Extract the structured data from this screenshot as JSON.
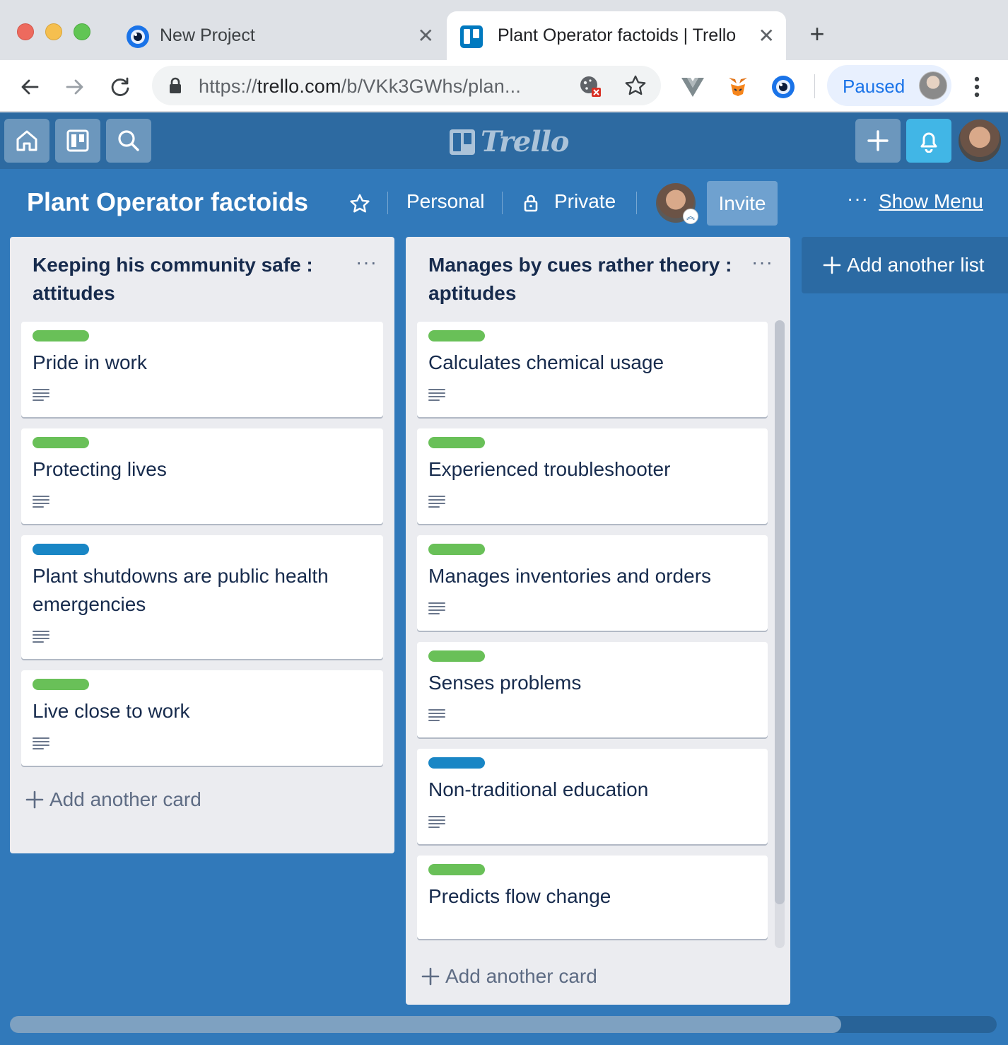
{
  "browser": {
    "tabs": [
      {
        "title": "New Project",
        "active": false
      },
      {
        "title": "Plant Operator factoids | Trello",
        "active": true
      }
    ],
    "url_scheme": "https://",
    "url_host": "trello.com",
    "url_path": "/b/VKk3GWhs/plan...",
    "profile_status": "Paused"
  },
  "board": {
    "title": "Plant Operator factoids",
    "team": "Personal",
    "visibility": "Private",
    "invite_label": "Invite",
    "show_menu_label": "Show Menu",
    "add_list_label": "Add another list",
    "colors": {
      "board_bg": "#3179ba",
      "header_bg": "#2d6aa1",
      "label_green": "#61bd4f",
      "label_blue": "#0079bf"
    }
  },
  "lists": [
    {
      "title": "Keeping his community safe : attitudes",
      "add_card_label": "Add another card",
      "cards": [
        {
          "label": "green",
          "title": "Pride in work"
        },
        {
          "label": "green",
          "title": "Protecting lives"
        },
        {
          "label": "blue",
          "title": "Plant shutdowns are public health emergencies"
        },
        {
          "label": "green",
          "title": "Live close to work"
        }
      ]
    },
    {
      "title": "Manages by cues rather theory : aptitudes",
      "add_card_label": "Add another card",
      "cards": [
        {
          "label": "green",
          "title": "Calculates chemical usage"
        },
        {
          "label": "green",
          "title": "Experienced troubleshooter"
        },
        {
          "label": "green",
          "title": "Manages inventories and orders"
        },
        {
          "label": "green",
          "title": "Senses problems"
        },
        {
          "label": "blue",
          "title": "Non-traditional education"
        },
        {
          "label": "green",
          "title": "Predicts flow change"
        }
      ]
    }
  ]
}
